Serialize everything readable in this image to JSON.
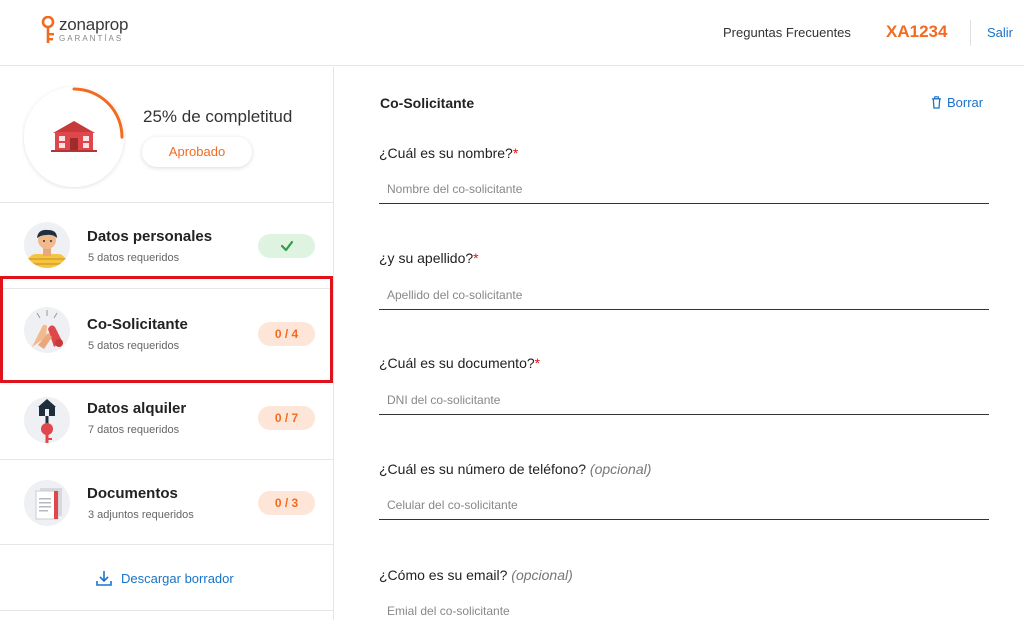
{
  "header": {
    "logo_main": "zonaprop",
    "logo_sub": "GARANTÍAS",
    "faq_label": "Preguntas Frecuentes",
    "user_code": "XA1234",
    "logout_label": "Salir"
  },
  "progress": {
    "label": "25% de completitud",
    "percent": 25,
    "status": "Aprobado"
  },
  "steps": [
    {
      "title": "Datos personales",
      "subtitle": "5 datos requeridos",
      "badge": "✓",
      "state": "done"
    },
    {
      "title": "Co-Solicitante",
      "subtitle": "5 datos requeridos",
      "badge": "0 / 4",
      "state": "active"
    },
    {
      "title": "Datos alquiler",
      "subtitle": "7 datos requeridos",
      "badge": "0 / 7",
      "state": "pending"
    },
    {
      "title": "Documentos",
      "subtitle": "3 adjuntos requeridos",
      "badge": "0 / 3",
      "state": "pending"
    }
  ],
  "download_label": "Descargar borrador",
  "form": {
    "title": "Co-Solicitante",
    "delete_label": "Borrar",
    "fields": [
      {
        "label": "¿Cuál es su nombre?",
        "required_mark": "*",
        "optional": "",
        "placeholder": "Nombre del co-solicitante",
        "value": ""
      },
      {
        "label": "¿y su apellido?",
        "required_mark": "*",
        "optional": "",
        "placeholder": "Apellido del co-solicitante",
        "value": ""
      },
      {
        "label": "¿Cuál es su documento?",
        "required_mark": "*",
        "optional": "",
        "placeholder": "DNI del co-solicitante",
        "value": ""
      },
      {
        "label": "¿Cuál es su número de teléfono?",
        "required_mark": "",
        "optional": "(opcional)",
        "placeholder": "Celular del co-solicitante",
        "value": ""
      },
      {
        "label": "¿Cómo es su email?",
        "required_mark": "",
        "optional": "(opcional)",
        "placeholder": "Emial del co-solicitante",
        "value": ""
      }
    ]
  },
  "colors": {
    "brand_orange": "#f26b21",
    "link_blue": "#1a73c8",
    "highlight_red": "#e0121b",
    "success_green": "#2e9e43"
  },
  "icons": {
    "logo": "key-pin-icon",
    "progress": "house-icon",
    "step_1": "person-avatar-icon",
    "step_2": "high-five-icon",
    "step_3": "house-key-icon",
    "step_4": "documents-icon",
    "download": "download-icon",
    "delete": "trash-icon"
  }
}
